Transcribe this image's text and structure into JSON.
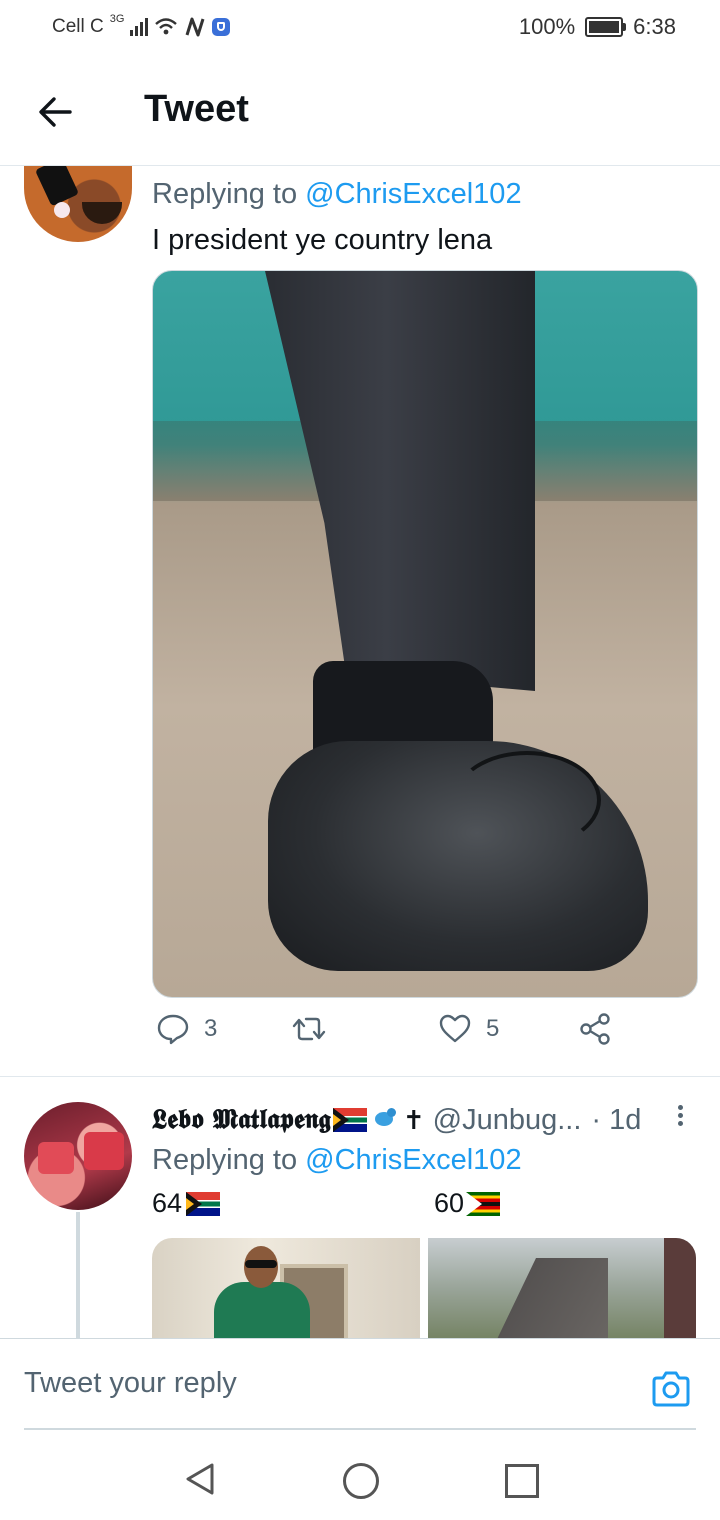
{
  "status_bar": {
    "carrier": "Cell C",
    "network_type": "3G",
    "battery": "100%",
    "time": "6:38"
  },
  "header": {
    "title": "Tweet"
  },
  "tweet1": {
    "replying_prefix": "Replying to",
    "replying_handle": "@ChrisExcel102",
    "text": "I president ye country lena",
    "actions": {
      "replies": "3",
      "retweets": "",
      "likes": "5"
    }
  },
  "tweet2": {
    "display_name": "𝕷𝖊𝖇𝖔 𝕸𝖆𝖙𝖑𝖆𝖕𝖊𝖓𝖌",
    "cross": "✝",
    "handle": "@Junbug...",
    "time": "· 1d",
    "replying_prefix": "Replying to",
    "replying_handle": "@ChrisExcel102",
    "score_left": "64",
    "score_right": "60"
  },
  "reply_bar": {
    "placeholder": "Tweet your reply"
  },
  "colors": {
    "accent": "#1d9bf0",
    "secondary_text": "#536471",
    "divider": "#e1e8ed"
  }
}
